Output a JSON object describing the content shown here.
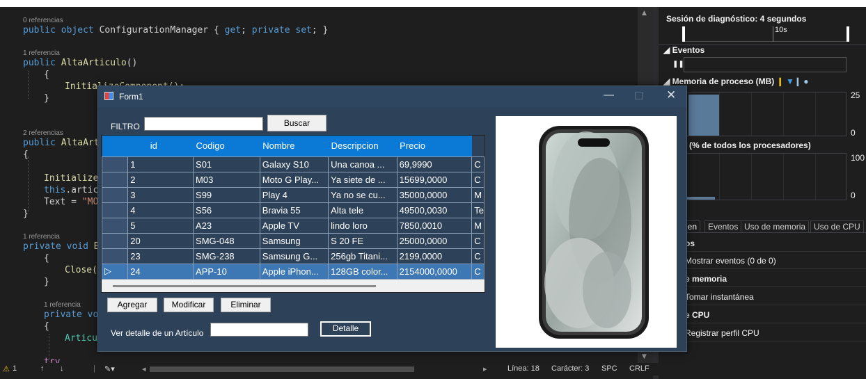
{
  "editor": {
    "refs": [
      "0 referencias",
      "1 referencia",
      "2 referencias",
      "1 referencia",
      "1 referencia"
    ],
    "code": {
      "l1": [
        "public",
        " object",
        " ConfigurationManager",
        " { ",
        "get",
        "; ",
        "private set",
        "; }"
      ],
      "l2a": "public",
      "l2b": " AltaArticulo",
      "l2c": "()",
      "l3": "{",
      "l4": "InitializeComponent();",
      "l5": "}",
      "l6a": "public",
      "l6b": " AltaArt",
      "l7": "{",
      "l8": "Initialize",
      "l9a": "this",
      "l9b": ".artic",
      "l10a": "Text = ",
      "l10b": "\"MO",
      "l11": "}",
      "l12a": "private",
      "l12b": " void",
      "l12c": " B",
      "l13": "{",
      "l14": "Close(",
      "l15": "}",
      "l16a": "private",
      "l16b": " vo",
      "l17": "{",
      "l18": "Articu",
      "l19": "try"
    }
  },
  "statusbar": {
    "warnings": "1",
    "line": "Línea: 18",
    "char": "Carácter: 3",
    "spc": "SPC",
    "crlf": "CRLF"
  },
  "diagnostics": {
    "session": "Sesión de diagnóstico: 4 segundos",
    "timeline_tick": "10s",
    "events": "Eventos",
    "memory": "Memoria de proceso (MB)",
    "memory_max": "25",
    "memory_min": "0",
    "memory_fill_fraction": 0.95,
    "cpu": "(% de todos los procesadores)",
    "cpu_max": "100",
    "cpu_min": "0",
    "tabs": [
      "nen",
      "Eventos",
      "Uso de memoria",
      "Uso de CPU"
    ],
    "sec1": "os",
    "show_events": "Mostrar eventos (0 de 0)",
    "sec2": "e memoria",
    "snapshot": "Tomar instantánea",
    "sec3": "e CPU",
    "cpu_profile": "Registrar perfil CPU"
  },
  "form": {
    "title": "Form1",
    "filter_label": "FILTRO",
    "filter_value": "",
    "search_button": "Buscar",
    "grid": {
      "columns": [
        "id",
        "Codigo",
        "Nombre",
        "Descripcion",
        "Precio",
        ""
      ],
      "rows": [
        [
          "1",
          "S01",
          "Galaxy S10",
          "Una canoa ...",
          "69,9990",
          "C"
        ],
        [
          "2",
          "M03",
          "Moto G Play...",
          "Ya siete de ...",
          "15699,0000",
          "C"
        ],
        [
          "3",
          "S99",
          "Play 4",
          "Ya no se cu...",
          "35000,0000",
          "M"
        ],
        [
          "4",
          "S56",
          "Bravia 55",
          "Alta tele",
          "49500,0030",
          "Te"
        ],
        [
          "5",
          "A23",
          "Apple TV",
          "lindo loro",
          "7850,0010",
          "M"
        ],
        [
          "20",
          "SMG-048",
          "Samsung",
          "S 20 FE",
          "25000,0000",
          "C"
        ],
        [
          "23",
          "SMG-238",
          "Samsung G...",
          "256gb Titani...",
          "2199,0000",
          "C"
        ],
        [
          "24",
          "APP-10",
          "Apple iPhon...",
          "128GB color...",
          "2154000,0000",
          "C"
        ]
      ],
      "selected_row": 7
    },
    "add_button": "Agregar",
    "edit_button": "Modificar",
    "delete_button": "Eliminar",
    "detail_label": "Ver detalle de un Artículo",
    "detail_value": "",
    "detail_button": "Detalle"
  }
}
